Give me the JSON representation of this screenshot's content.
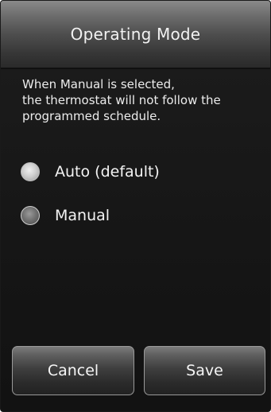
{
  "header": {
    "title": "Operating Mode"
  },
  "description": {
    "lines": [
      "When Manual is selected,",
      "the thermostat will not follow the",
      "programmed schedule."
    ]
  },
  "options": [
    {
      "label": "Auto (default)",
      "selected": true
    },
    {
      "label": "Manual",
      "selected": false
    }
  ],
  "buttons": {
    "cancel_label": "Cancel",
    "save_label": "Save"
  },
  "colors": {
    "background": "#141414",
    "text": "#f2f2f2"
  }
}
